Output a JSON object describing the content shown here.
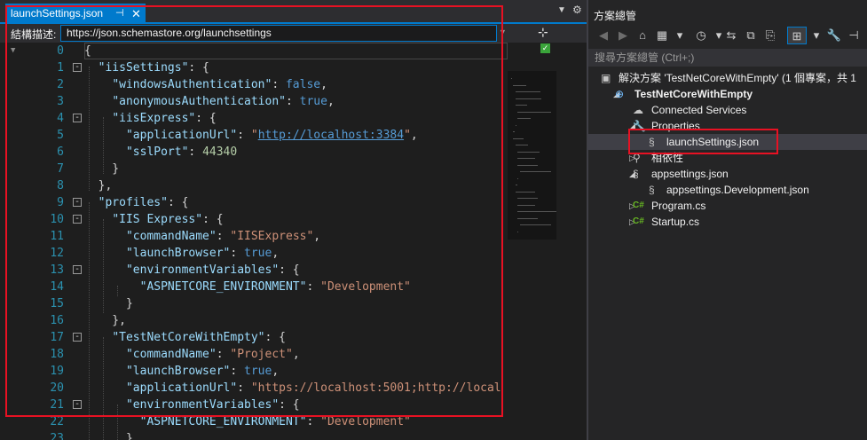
{
  "editor": {
    "tab": {
      "title": "launchSettings.json",
      "pin_icon": "pin-icon",
      "close_icon": "close-icon"
    },
    "schema": {
      "label": "結構描述:",
      "url": "https://json.schemastore.org/launchsettings"
    },
    "lines": [
      {
        "num": "0",
        "fold": "",
        "tokens": [
          {
            "t": "p",
            "v": "{"
          }
        ]
      },
      {
        "num": "1",
        "fold": "-",
        "tokens": [
          {
            "t": "p",
            "v": "  "
          },
          {
            "t": "k",
            "v": "\"iisSettings\""
          },
          {
            "t": "p",
            "v": ": {"
          }
        ]
      },
      {
        "num": "2",
        "fold": "",
        "tokens": [
          {
            "t": "p",
            "v": "    "
          },
          {
            "t": "k",
            "v": "\"windowsAuthentication\""
          },
          {
            "t": "p",
            "v": ": "
          },
          {
            "t": "kw",
            "v": "false"
          },
          {
            "t": "p",
            "v": ","
          }
        ]
      },
      {
        "num": "3",
        "fold": "",
        "tokens": [
          {
            "t": "p",
            "v": "    "
          },
          {
            "t": "k",
            "v": "\"anonymousAuthentication\""
          },
          {
            "t": "p",
            "v": ": "
          },
          {
            "t": "kw",
            "v": "true"
          },
          {
            "t": "p",
            "v": ","
          }
        ]
      },
      {
        "num": "4",
        "fold": "-",
        "tokens": [
          {
            "t": "p",
            "v": "    "
          },
          {
            "t": "k",
            "v": "\"iisExpress\""
          },
          {
            "t": "p",
            "v": ": {"
          }
        ]
      },
      {
        "num": "5",
        "fold": "",
        "tokens": [
          {
            "t": "p",
            "v": "      "
          },
          {
            "t": "k",
            "v": "\"applicationUrl\""
          },
          {
            "t": "p",
            "v": ": "
          },
          {
            "t": "s",
            "v": "\""
          },
          {
            "t": "u",
            "v": "http://localhost:3384"
          },
          {
            "t": "s",
            "v": "\""
          },
          {
            "t": "p",
            "v": ","
          }
        ]
      },
      {
        "num": "6",
        "fold": "",
        "tokens": [
          {
            "t": "p",
            "v": "      "
          },
          {
            "t": "k",
            "v": "\"sslPort\""
          },
          {
            "t": "p",
            "v": ": "
          },
          {
            "t": "n",
            "v": "44340"
          }
        ]
      },
      {
        "num": "7",
        "fold": "",
        "tokens": [
          {
            "t": "p",
            "v": "    }"
          }
        ]
      },
      {
        "num": "8",
        "fold": "",
        "tokens": [
          {
            "t": "p",
            "v": "  },"
          }
        ]
      },
      {
        "num": "9",
        "fold": "-",
        "tokens": [
          {
            "t": "p",
            "v": "  "
          },
          {
            "t": "k",
            "v": "\"profiles\""
          },
          {
            "t": "p",
            "v": ": {"
          }
        ]
      },
      {
        "num": "10",
        "fold": "-",
        "tokens": [
          {
            "t": "p",
            "v": "    "
          },
          {
            "t": "k",
            "v": "\"IIS Express\""
          },
          {
            "t": "p",
            "v": ": {"
          }
        ]
      },
      {
        "num": "11",
        "fold": "",
        "tokens": [
          {
            "t": "p",
            "v": "      "
          },
          {
            "t": "k",
            "v": "\"commandName\""
          },
          {
            "t": "p",
            "v": ": "
          },
          {
            "t": "s",
            "v": "\"IISExpress\""
          },
          {
            "t": "p",
            "v": ","
          }
        ]
      },
      {
        "num": "12",
        "fold": "",
        "tokens": [
          {
            "t": "p",
            "v": "      "
          },
          {
            "t": "k",
            "v": "\"launchBrowser\""
          },
          {
            "t": "p",
            "v": ": "
          },
          {
            "t": "kw",
            "v": "true"
          },
          {
            "t": "p",
            "v": ","
          }
        ]
      },
      {
        "num": "13",
        "fold": "-",
        "tokens": [
          {
            "t": "p",
            "v": "      "
          },
          {
            "t": "k",
            "v": "\"environmentVariables\""
          },
          {
            "t": "p",
            "v": ": {"
          }
        ]
      },
      {
        "num": "14",
        "fold": "",
        "tokens": [
          {
            "t": "p",
            "v": "        "
          },
          {
            "t": "k",
            "v": "\"ASPNETCORE_ENVIRONMENT\""
          },
          {
            "t": "p",
            "v": ": "
          },
          {
            "t": "s",
            "v": "\"Development\""
          }
        ]
      },
      {
        "num": "15",
        "fold": "",
        "tokens": [
          {
            "t": "p",
            "v": "      }"
          }
        ]
      },
      {
        "num": "16",
        "fold": "",
        "tokens": [
          {
            "t": "p",
            "v": "    },"
          }
        ]
      },
      {
        "num": "17",
        "fold": "-",
        "tokens": [
          {
            "t": "p",
            "v": "    "
          },
          {
            "t": "k",
            "v": "\"TestNetCoreWithEmpty\""
          },
          {
            "t": "p",
            "v": ": {"
          }
        ]
      },
      {
        "num": "18",
        "fold": "",
        "tokens": [
          {
            "t": "p",
            "v": "      "
          },
          {
            "t": "k",
            "v": "\"commandName\""
          },
          {
            "t": "p",
            "v": ": "
          },
          {
            "t": "s",
            "v": "\"Project\""
          },
          {
            "t": "p",
            "v": ","
          }
        ]
      },
      {
        "num": "19",
        "fold": "",
        "tokens": [
          {
            "t": "p",
            "v": "      "
          },
          {
            "t": "k",
            "v": "\"launchBrowser\""
          },
          {
            "t": "p",
            "v": ": "
          },
          {
            "t": "kw",
            "v": "true"
          },
          {
            "t": "p",
            "v": ","
          }
        ]
      },
      {
        "num": "20",
        "fold": "",
        "tokens": [
          {
            "t": "p",
            "v": "      "
          },
          {
            "t": "k",
            "v": "\"applicationUrl\""
          },
          {
            "t": "p",
            "v": ": "
          },
          {
            "t": "s",
            "v": "\"https://localhost:5001;http://local"
          }
        ]
      },
      {
        "num": "21",
        "fold": "-",
        "tokens": [
          {
            "t": "p",
            "v": "      "
          },
          {
            "t": "k",
            "v": "\"environmentVariables\""
          },
          {
            "t": "p",
            "v": ": {"
          }
        ]
      },
      {
        "num": "22",
        "fold": "",
        "tokens": [
          {
            "t": "p",
            "v": "        "
          },
          {
            "t": "k",
            "v": "\"ASPNETCORE_ENVIRONMENT\""
          },
          {
            "t": "p",
            "v": ": "
          },
          {
            "t": "s",
            "v": "\"Development\""
          }
        ]
      },
      {
        "num": "23",
        "fold": "",
        "tokens": [
          {
            "t": "p",
            "v": "      }"
          }
        ]
      }
    ]
  },
  "explorer": {
    "title": "方案總管",
    "search_placeholder": "搜尋方案總管 (Ctrl+;)",
    "tree": [
      {
        "id": "node-solution",
        "label": "解決方案 'TestNetCoreWithEmpty' (1 個專案，共 1",
        "icon": "solution-icon",
        "glyph": "▣",
        "glyph_color": "#c5c5c5",
        "arrow": ""
      },
      {
        "id": "node-project",
        "label": "TestNetCoreWithEmpty",
        "icon": "web-project-icon",
        "glyph": "⊕",
        "glyph_color": "#75beff",
        "arrow": "◢",
        "bold": true
      },
      {
        "id": "node-connected",
        "label": "Connected Services",
        "icon": "cloud-icon",
        "glyph": "☁",
        "glyph_color": "#c5c5c5",
        "arrow": ""
      },
      {
        "id": "node-properties",
        "label": "Properties",
        "icon": "properties-icon",
        "glyph": "🔧",
        "glyph_color": "#c5c5c5",
        "arrow": "◢"
      },
      {
        "id": "node-launch",
        "label": "launchSettings.json",
        "icon": "json-file-icon",
        "glyph": "§",
        "glyph_color": "#c5c5c5",
        "arrow": ""
      },
      {
        "id": "node-deps",
        "label": "相依性",
        "icon": "dependencies-icon",
        "glyph": "⚲",
        "glyph_color": "#c5c5c5",
        "arrow": "▷"
      },
      {
        "id": "node-appsettings",
        "label": "appsettings.json",
        "icon": "json-file-icon",
        "glyph": "§",
        "glyph_color": "#c5c5c5",
        "arrow": "◢"
      },
      {
        "id": "node-appsettings-dev",
        "label": "appsettings.Development.json",
        "icon": "json-file-icon",
        "glyph": "§",
        "glyph_color": "#c5c5c5",
        "arrow": ""
      },
      {
        "id": "node-program",
        "label": "Program.cs",
        "icon": "csharp-file-icon",
        "glyph": "C#",
        "glyph_color": "#68b723",
        "arrow": "▷"
      },
      {
        "id": "node-startup",
        "label": "Startup.cs",
        "icon": "csharp-file-icon",
        "glyph": "C#",
        "glyph_color": "#68b723",
        "arrow": "▷"
      }
    ]
  },
  "colors": {
    "accent": "#007acc",
    "highlight_box": "#e81123",
    "editor_bg": "#1e1e1e",
    "panel_bg": "#252526"
  }
}
